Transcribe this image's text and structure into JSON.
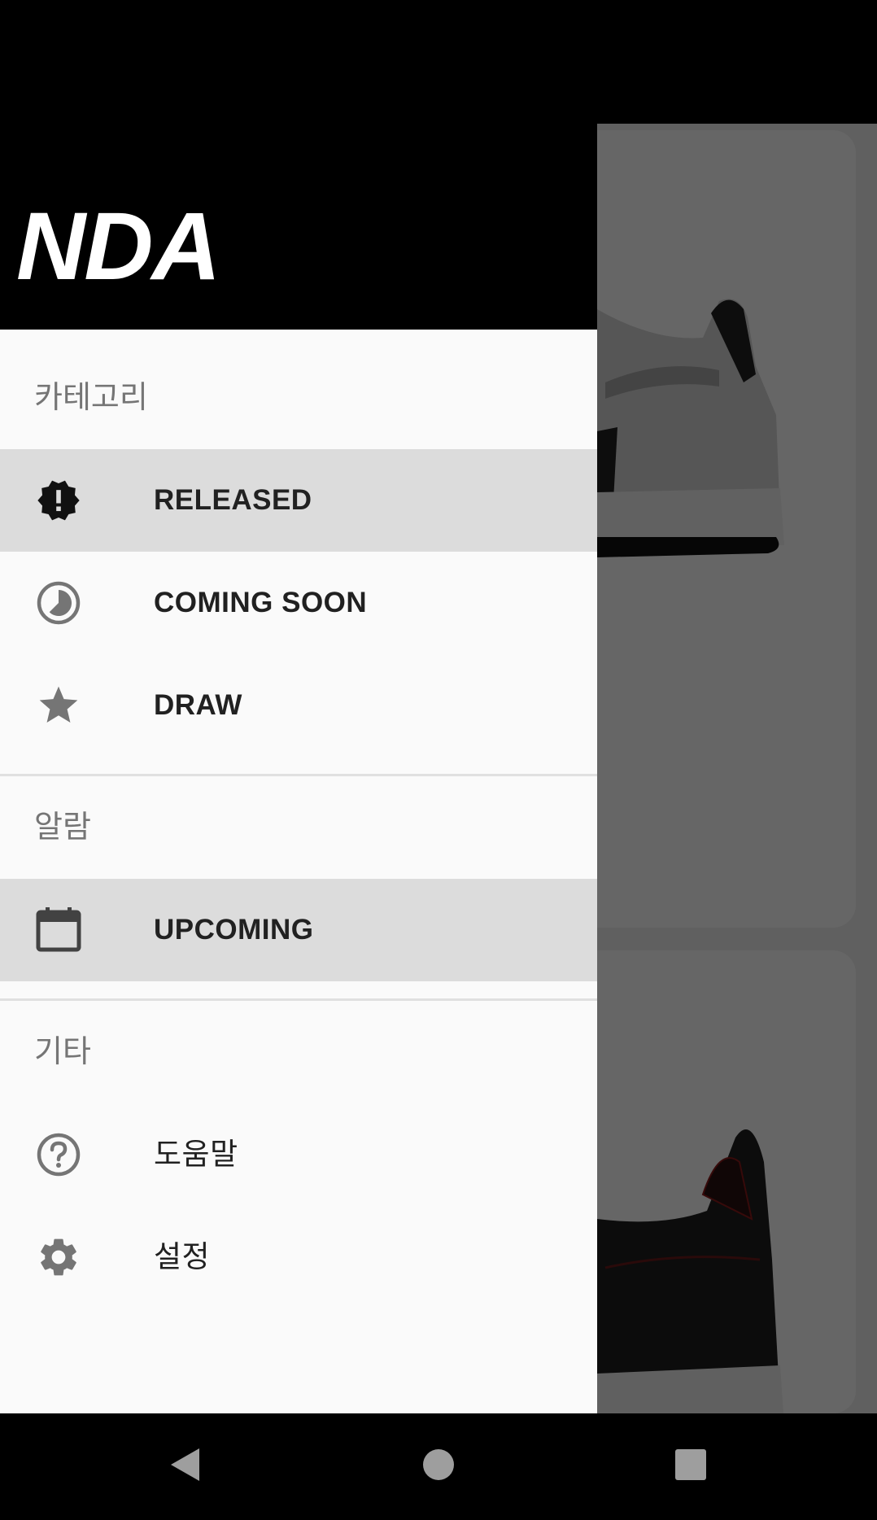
{
  "app": {
    "logo": "NDA"
  },
  "drawer": {
    "sections": [
      {
        "label": "카테고리"
      },
      {
        "label": "알람"
      },
      {
        "label": "기타"
      }
    ],
    "items": [
      {
        "label": "RELEASED",
        "icon": "new-releases-icon",
        "active": true
      },
      {
        "label": "COMING SOON",
        "icon": "clock-icon",
        "active": false
      },
      {
        "label": "DRAW",
        "icon": "star-icon",
        "active": false
      },
      {
        "label": "UPCOMING",
        "icon": "calendar-icon",
        "active": true
      },
      {
        "label": "도움말",
        "icon": "help-icon",
        "active": false
      },
      {
        "label": "설정",
        "icon": "settings-icon",
        "active": false
      }
    ]
  },
  "navbar": {
    "buttons": [
      "back-icon",
      "home-icon",
      "recents-icon"
    ]
  },
  "colors": {
    "header": "#000000",
    "drawer_bg": "#fafafa",
    "active_bg": "#dcdcdc",
    "icon": "#757575"
  }
}
